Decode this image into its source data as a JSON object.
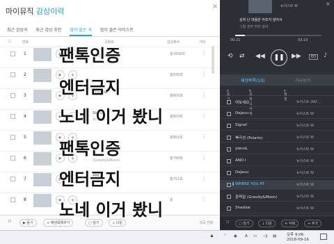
{
  "header": {
    "prefix": "마이뮤직",
    "accent_title": "감상이력",
    "close": "×"
  },
  "tabs": [
    "최근 감상곡",
    "최근 감상 추천",
    "많이 들은 곡",
    "많이 들은 아티스트"
  ],
  "active_tab": 2,
  "table_header": {
    "num": "번호",
    "title": "곡정보",
    "count": "감상횟수",
    "etc": "기타"
  },
  "rows": [
    {
      "num": "1",
      "title": "",
      "artist": "WHO, YOU",
      "count": "총1608회"
    },
    {
      "num": "2",
      "title": "",
      "artist": "",
      "count": "총836회"
    },
    {
      "num": "3",
      "title": "Shadow",
      "artist": "",
      "count": "총805회"
    },
    {
      "num": "4",
      "title": "Signal",
      "artist": "뉴이스트 W",
      "count": "총803회"
    },
    {
      "num": "5",
      "title": "",
      "artist": "",
      "count": "총801회"
    },
    {
      "num": "6",
      "title": "",
      "artist": "(Gravity&Moon)",
      "count": "총799회"
    },
    {
      "num": "7",
      "title": "AND I",
      "artist": "",
      "count": "총751회"
    },
    {
      "num": "8",
      "title": "",
      "artist": "",
      "count": "총"
    }
  ],
  "bottom": {
    "listen": "듣기",
    "add_playlist": "재생목록추가",
    "save": "담기",
    "download": "다운",
    "selected": "0곡 선택"
  },
  "player": {
    "artist_top": "뉴이스트 W",
    "lyric1": "상처 난 마음은 아프지 않아서",
    "lyric2": "그럴 생각 하지 않아",
    "time_current": "00:21",
    "time_total": "03:10",
    "progress": 0.11,
    "eq_label": "EQ"
  },
  "playlist_tabs": {
    "active": "재생목록(10)",
    "inactive": "가사보기"
  },
  "playlist_tools": {
    "listen": "듣기",
    "repeat": "중복곡삭제",
    "sort": "정렬"
  },
  "playlist": [
    {
      "title": "여보세요",
      "artist": "뉴이스트 (NU'..."
    },
    {
      "title": "Dejavu",
      "artist": "뉴이스트 W"
    },
    {
      "title": "Signal",
      "artist": "뉴이스트 W"
    },
    {
      "title": "북극성 (Polaris)",
      "artist": "뉴이스트 W"
    },
    {
      "title": "ylenoL",
      "artist": "뉴이스트 W"
    },
    {
      "title": "AND I",
      "artist": "뉴이스트 W"
    },
    {
      "title": "Dejavu",
      "artist": "뉴이스트 W"
    },
    {
      "title": "WHERE YOU AT",
      "artist": "뉴이스트 W",
      "playing": true
    },
    {
      "title": "중력달 (Gravity&Moon)",
      "artist": "뉴이스트 W"
    },
    {
      "title": "Shadow",
      "artist": "뉴이스트 W"
    }
  ],
  "playlist_bottom": {
    "save": "담기",
    "download": "다운",
    "delete": "삭제",
    "add": "추가"
  },
  "taskbar": {
    "ime": "A",
    "time_ampm": "오후 9:06",
    "date": "2018-09-16"
  },
  "overlay": [
    "팬톡인증",
    "엔터금지",
    "노네 이거 봤니",
    "팬톡인증",
    "엔터금지",
    "노네 이거 봤니"
  ]
}
